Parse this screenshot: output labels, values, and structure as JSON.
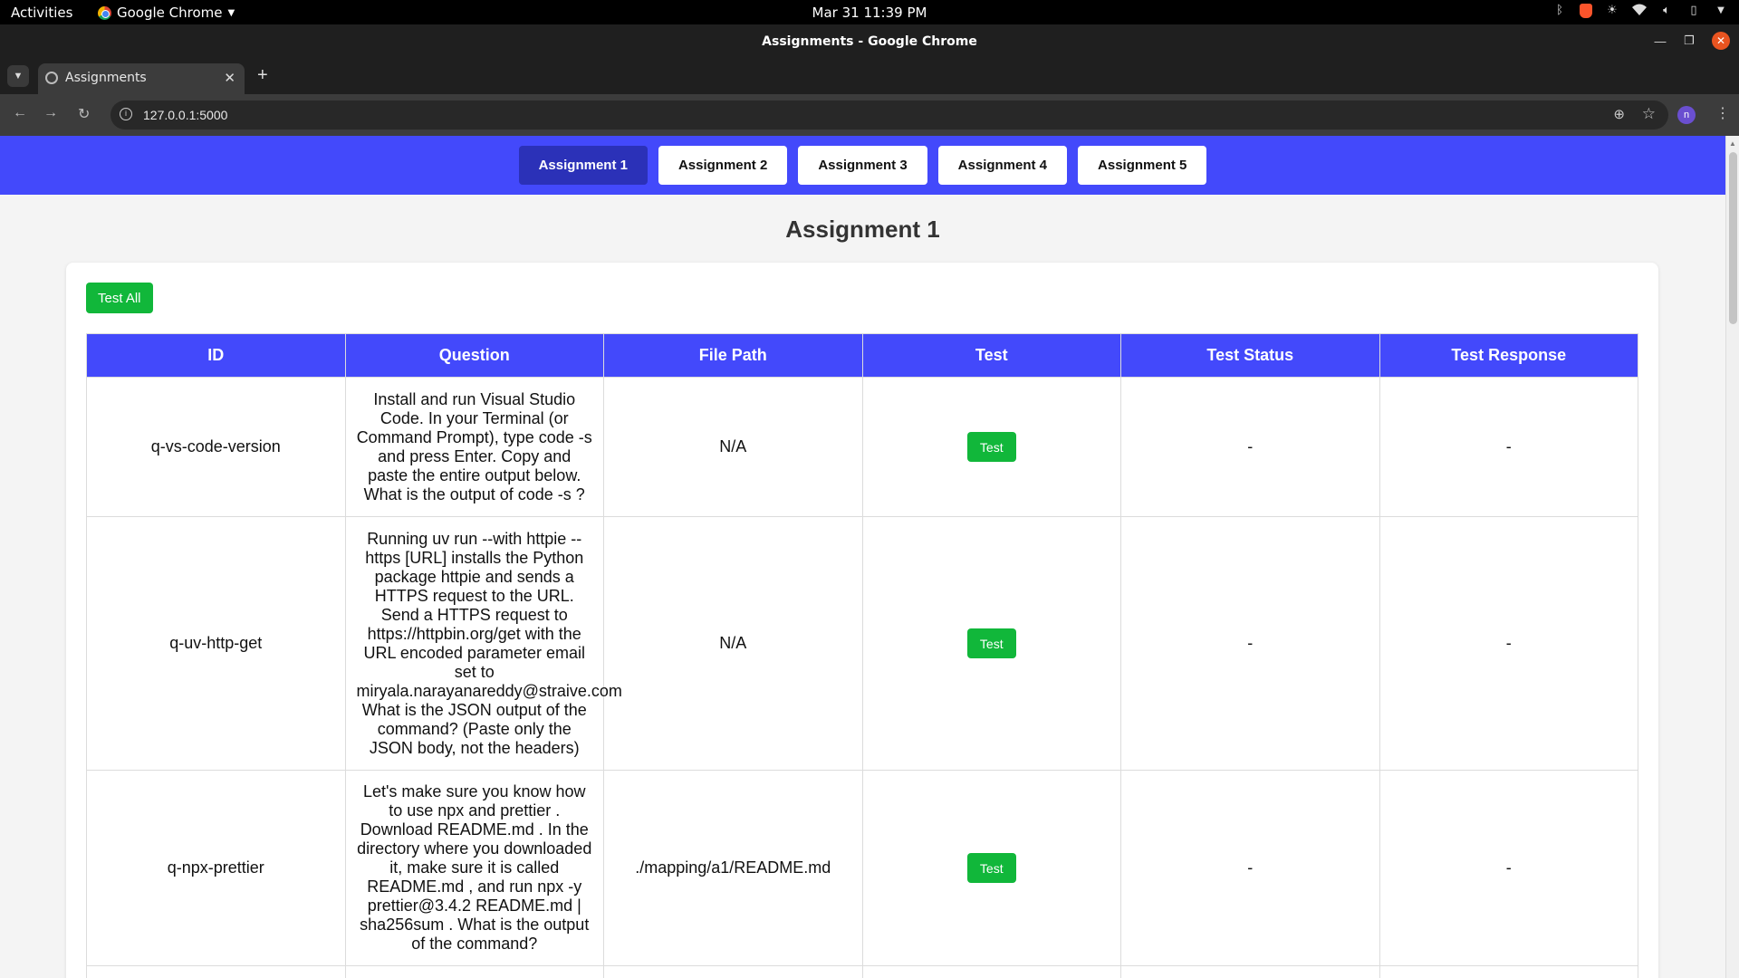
{
  "os": {
    "activities": "Activities",
    "app_name": "Google Chrome",
    "clock": "Mar 31  11:39 PM"
  },
  "window": {
    "title": "Assignments - Google Chrome"
  },
  "browser": {
    "tab_title": "Assignments",
    "url": "127.0.0.1:5000",
    "profile_initial": "n"
  },
  "nav": {
    "buttons": [
      "Assignment 1",
      "Assignment 2",
      "Assignment 3",
      "Assignment 4",
      "Assignment 5"
    ],
    "active_index": 0
  },
  "page": {
    "title": "Assignment 1",
    "test_all_label": "Test All"
  },
  "table": {
    "headers": [
      "ID",
      "Question",
      "File Path",
      "Test",
      "Test Status",
      "Test Response"
    ],
    "rows": [
      {
        "id": "q-vs-code-version",
        "question": "Install and run Visual Studio Code. In your Terminal (or Command Prompt), type code -s and press Enter. Copy and paste the entire output below. What is the output of code -s ?",
        "file_path": "N/A",
        "test_label": "Test",
        "status": "-",
        "response": "-"
      },
      {
        "id": "q-uv-http-get",
        "question": "Running uv run --with httpie -- https [URL] installs the Python package httpie and sends a HTTPS request to the URL. Send a HTTPS request to https://httpbin.org/get with the URL encoded parameter email set to miryala.narayanareddy@straive.com What is the JSON output of the command? (Paste only the JSON body, not the headers)",
        "file_path": "N/A",
        "test_label": "Test",
        "status": "-",
        "response": "-"
      },
      {
        "id": "q-npx-prettier",
        "question": "Let's make sure you know how to use npx and prettier . Download README.md . In the directory where you downloaded it, make sure it is called README.md , and run npx -y prettier@3.4.2 README.md | sha256sum . What is the output of the command?",
        "file_path": "./mapping/a1/README.md",
        "test_label": "Test",
        "status": "-",
        "response": "-"
      }
    ]
  },
  "colors": {
    "accent": "#4349fb",
    "active_nav": "#2b31b8",
    "success": "#11b73a"
  }
}
